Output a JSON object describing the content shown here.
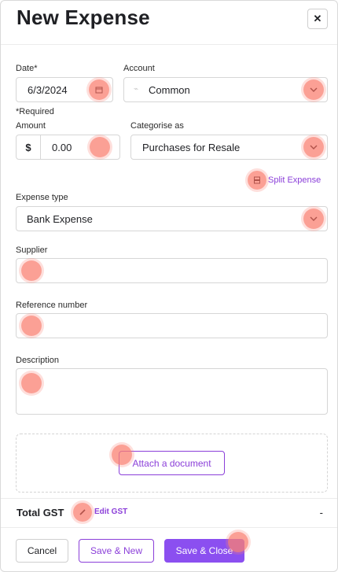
{
  "header": {
    "title": "New Expense",
    "close_symbol": "✕"
  },
  "date": {
    "label": "Date*",
    "value": "6/3/2024",
    "required_note": "*Required"
  },
  "account": {
    "label": "Account",
    "value": "Common",
    "prefix_symbol": "⌁"
  },
  "amount": {
    "label": "Amount",
    "currency": "$",
    "value": "0.00"
  },
  "categorise": {
    "label": "Categorise as",
    "value": "Purchases for Resale"
  },
  "split": {
    "label": "Split Expense"
  },
  "expense_type": {
    "label": "Expense type",
    "value": "Bank Expense"
  },
  "supplier": {
    "label": "Supplier",
    "value": ""
  },
  "reference": {
    "label": "Reference number",
    "value": ""
  },
  "description": {
    "label": "Description",
    "value": ""
  },
  "attach": {
    "label": "Attach a document"
  },
  "gst": {
    "label": "Total GST",
    "edit_label": "Edit GST",
    "value": "-"
  },
  "footer": {
    "cancel_label": "Cancel",
    "save_new_label": "Save & New",
    "save_close_label": "Save & Close"
  },
  "colors": {
    "accent": "#8b3fd9",
    "primary_button": "#8b4ff0",
    "highlight": "#fa8072"
  }
}
